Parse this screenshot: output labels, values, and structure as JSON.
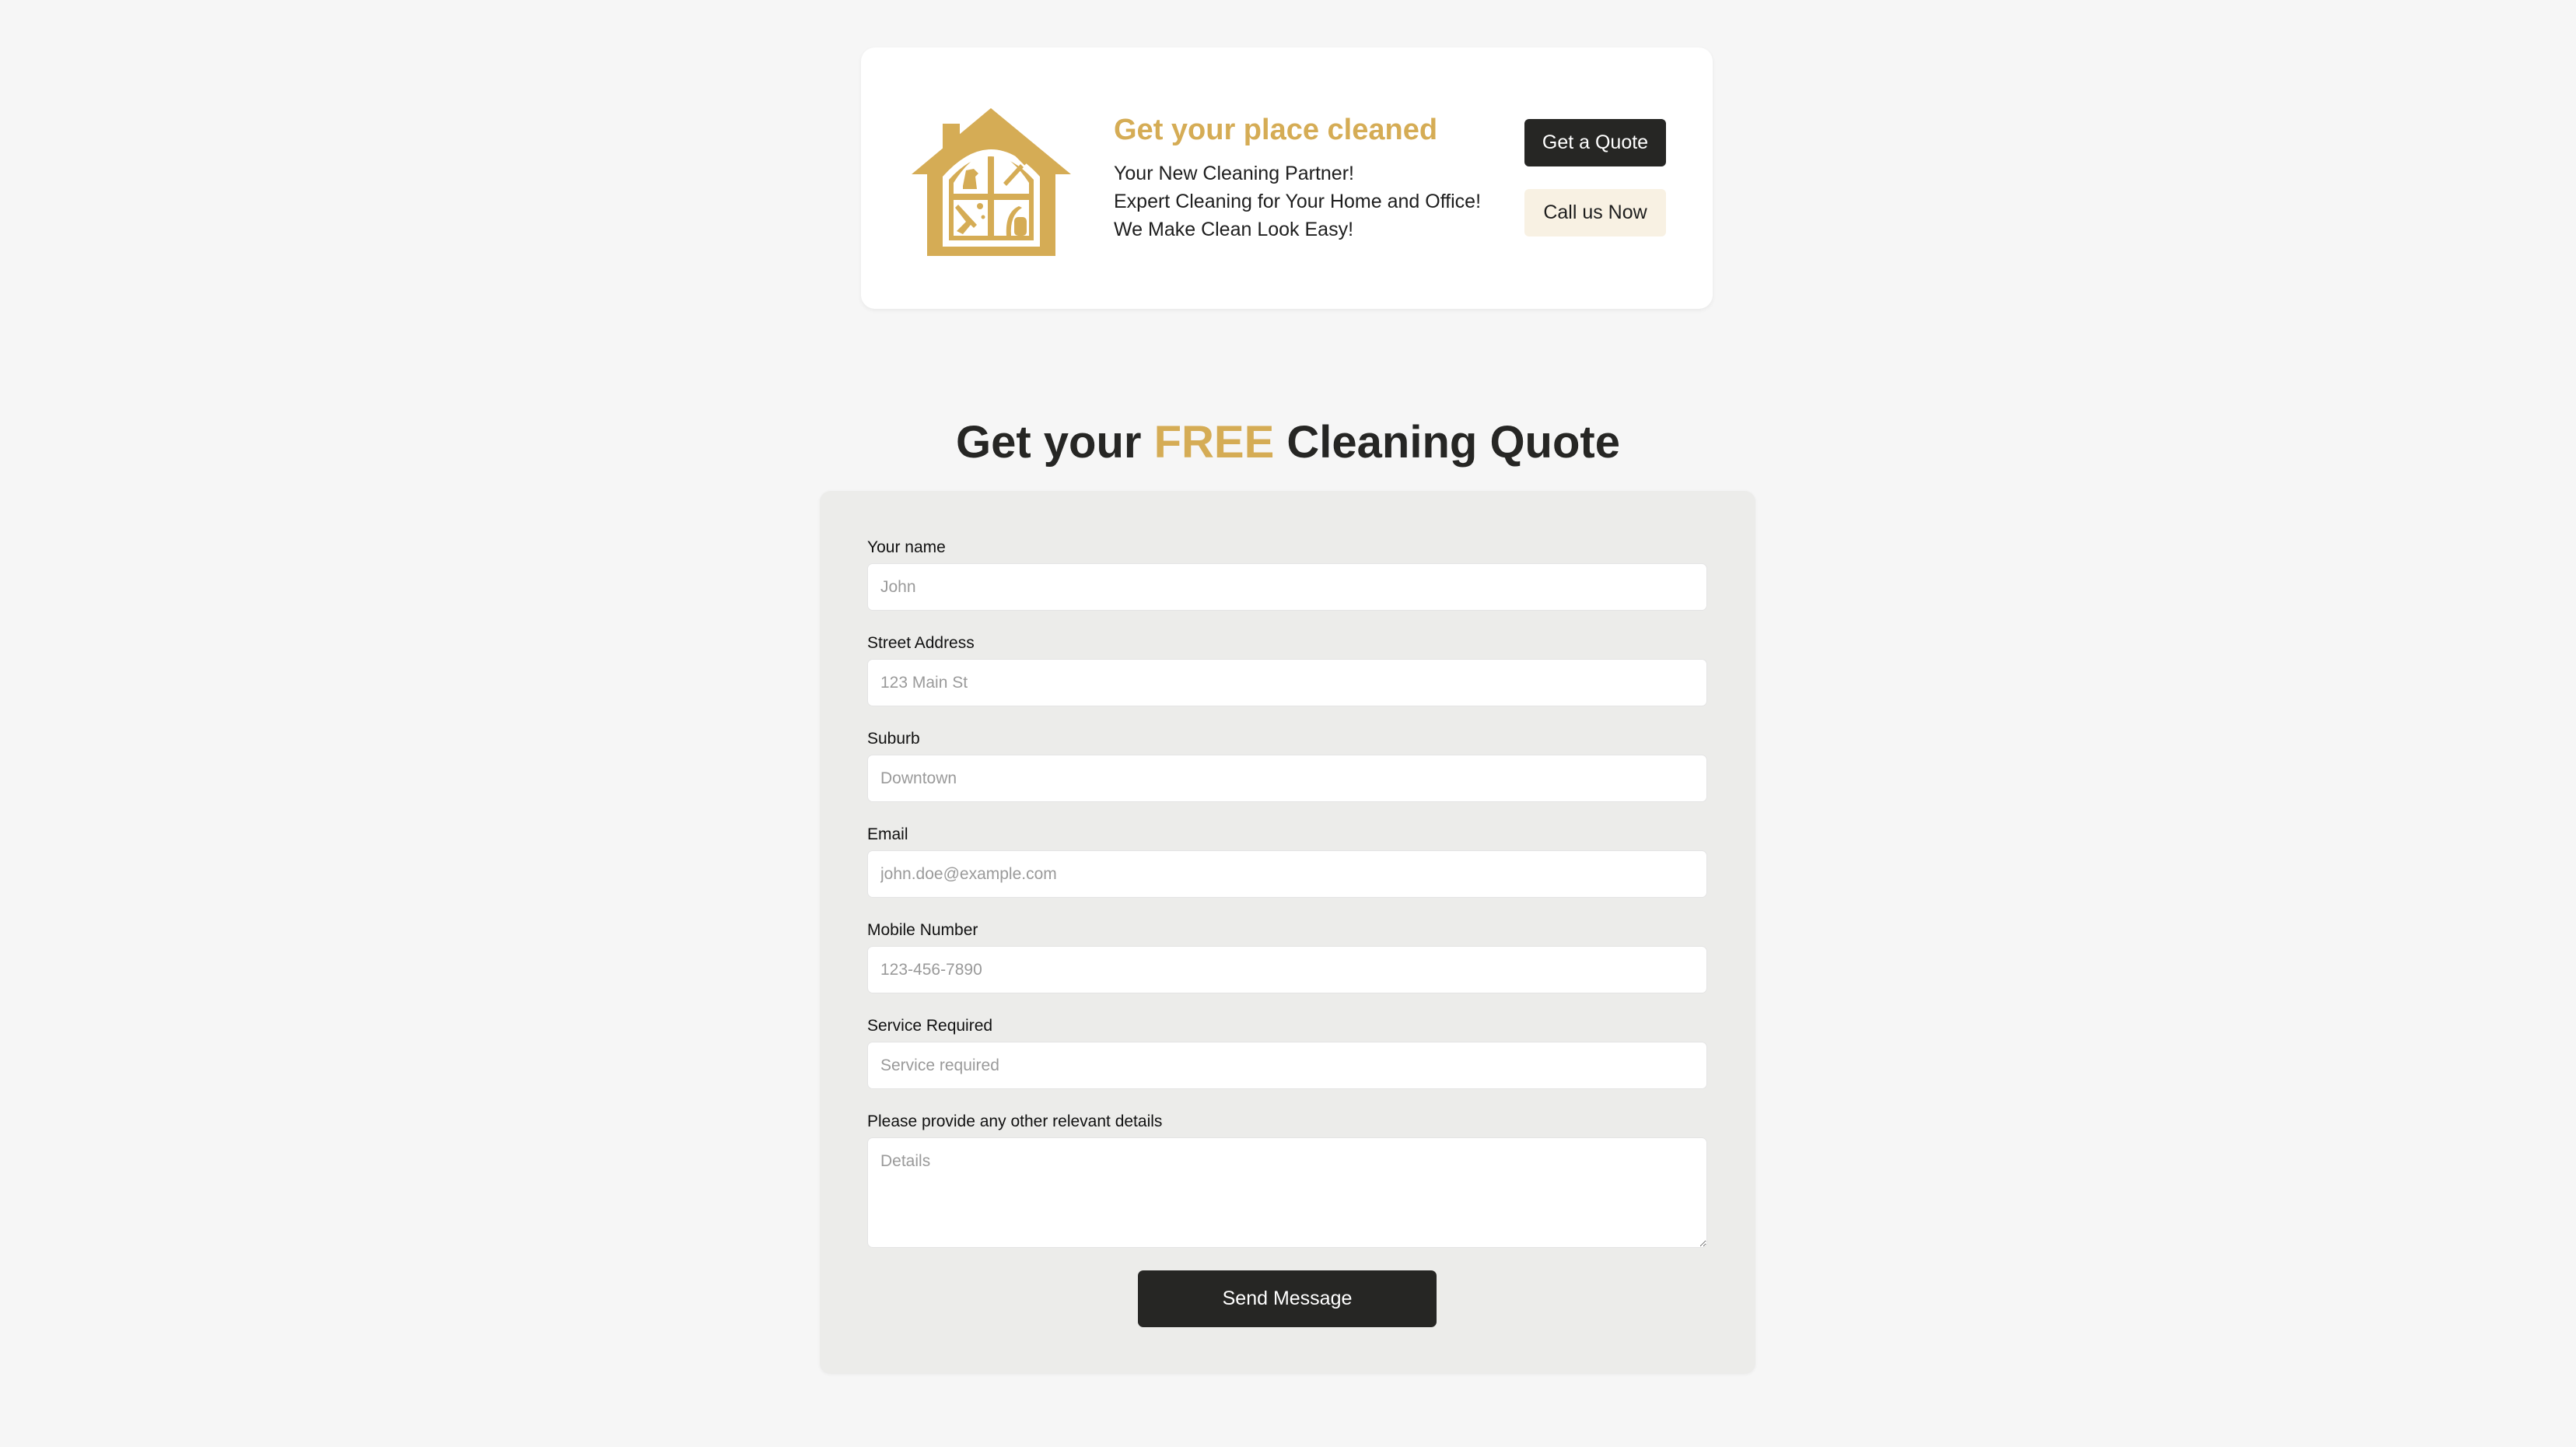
{
  "hero": {
    "title": "Get your place cleaned",
    "lines": [
      "Your New Cleaning Partner!",
      "Expert Cleaning for Your Home and Office!",
      "We Make Clean Look Easy!"
    ],
    "quote_button": "Get a Quote",
    "call_button": "Call us Now",
    "logo_icon": "house-cleaning-logo-icon"
  },
  "quote_section": {
    "title_before": "Get your ",
    "title_accent": "FREE",
    "title_after": " Cleaning Quote"
  },
  "form": {
    "fields": [
      {
        "label": "Your name",
        "placeholder": "John"
      },
      {
        "label": "Street Address",
        "placeholder": "123 Main St"
      },
      {
        "label": "Suburb",
        "placeholder": "Downtown"
      },
      {
        "label": "Email",
        "placeholder": "john.doe@example.com"
      },
      {
        "label": "Mobile Number",
        "placeholder": "123-456-7890"
      },
      {
        "label": "Service Required",
        "placeholder": "Service required"
      },
      {
        "label": "Please provide any other relevant details",
        "placeholder": "Details"
      }
    ],
    "submit_label": "Send Message"
  },
  "colors": {
    "accent": "#d5ac55",
    "dark": "#262624",
    "page_bg": "#f6f6f6",
    "form_bg": "#ececea",
    "call_bg": "#f8f1e3"
  }
}
